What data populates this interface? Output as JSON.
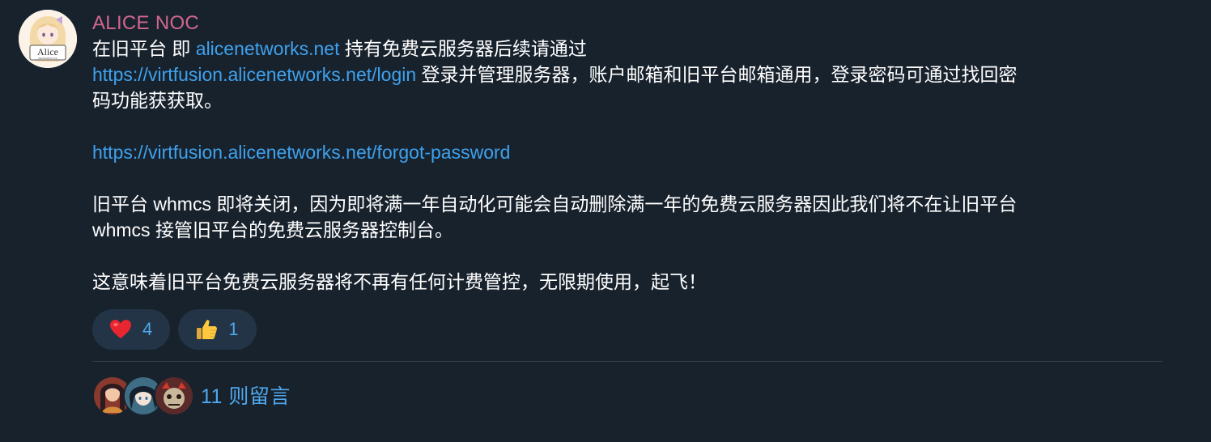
{
  "message": {
    "sender": "ALICE NOC",
    "avatar_text": "Alice",
    "avatar_subtext": "NETWORKS LTD",
    "line1_prefix": "在旧平台 即 ",
    "line1_link": "alicenetworks.net",
    "line1_suffix": " 持有免费云服务器后续请通过",
    "line2_link": "https://virtfusion.alicenetworks.net/login",
    "line2_suffix": " 登录并管理服务器，账户邮箱和旧平台邮箱通用，登录密码可通过找回密",
    "line3": "码功能获获取。",
    "forgot_link": "https://virtfusion.alicenetworks.net/forgot-password",
    "para2_line1": "旧平台 whmcs 即将关闭，因为即将满一年自动化可能会自动删除满一年的免费云服务器因此我们将不在让旧平台",
    "para2_line2": " whmcs 接管旧平台的免费云服务器控制台。",
    "para3": "这意味着旧平台免费云服务器将不再有任何计费管控，无限期使用，起飞！"
  },
  "reactions": [
    {
      "emoji": "heart-icon",
      "count": "4"
    },
    {
      "emoji": "thumbs-up-icon",
      "count": "1"
    }
  ],
  "comments": {
    "label": "11 则留言"
  },
  "colors": {
    "background": "#18222d",
    "sender": "#d2678f",
    "link": "#3ea2ee",
    "reaction_bg": "#223446"
  }
}
